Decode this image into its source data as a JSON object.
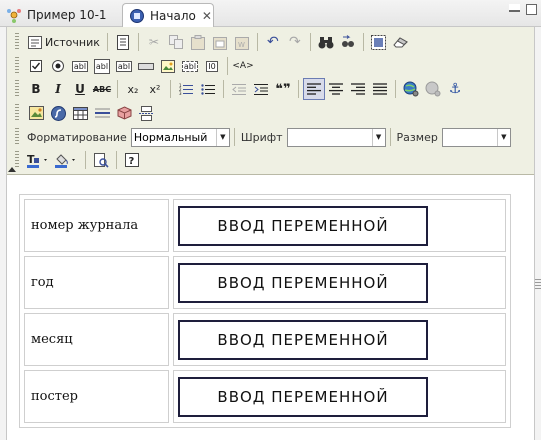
{
  "tabs": [
    {
      "label": "Пример 10-1",
      "icon": "project-icon",
      "active": false
    },
    {
      "label": "Начало",
      "icon": "page-icon",
      "active": true,
      "close": "✕"
    }
  ],
  "window_controls": [
    "minimize",
    "maximize"
  ],
  "toolbar": {
    "source_label": "Источник",
    "formatting_label": "Форматирование",
    "formatting_value": "Нормальный",
    "font_label": "Шрифт",
    "font_value": "",
    "size_label": "Размер",
    "size_value": "",
    "glyphs": {
      "bold": "B",
      "italic": "I",
      "underline": "U",
      "strike": "ABC",
      "subscript": "x₂",
      "superscript": "x²",
      "quote": "❝❞",
      "form_text": "abl",
      "form_iframe": "I0",
      "form_tag": "<A>"
    }
  },
  "rows": [
    {
      "label": "номер журнала",
      "field": "ВВОД ПЕРЕМЕННОЙ"
    },
    {
      "label": "год",
      "field": "ВВОД ПЕРЕМЕННОЙ"
    },
    {
      "label": "месяц",
      "field": "ВВОД ПЕРЕМЕННОЙ"
    },
    {
      "label": "постер",
      "field": "ВВОД ПЕРЕМЕННОЙ"
    }
  ],
  "colors": {
    "toolbar_bg": "#eff0e3",
    "active_button_border": "#6b7cb3",
    "field_border": "#1e1e3c"
  }
}
